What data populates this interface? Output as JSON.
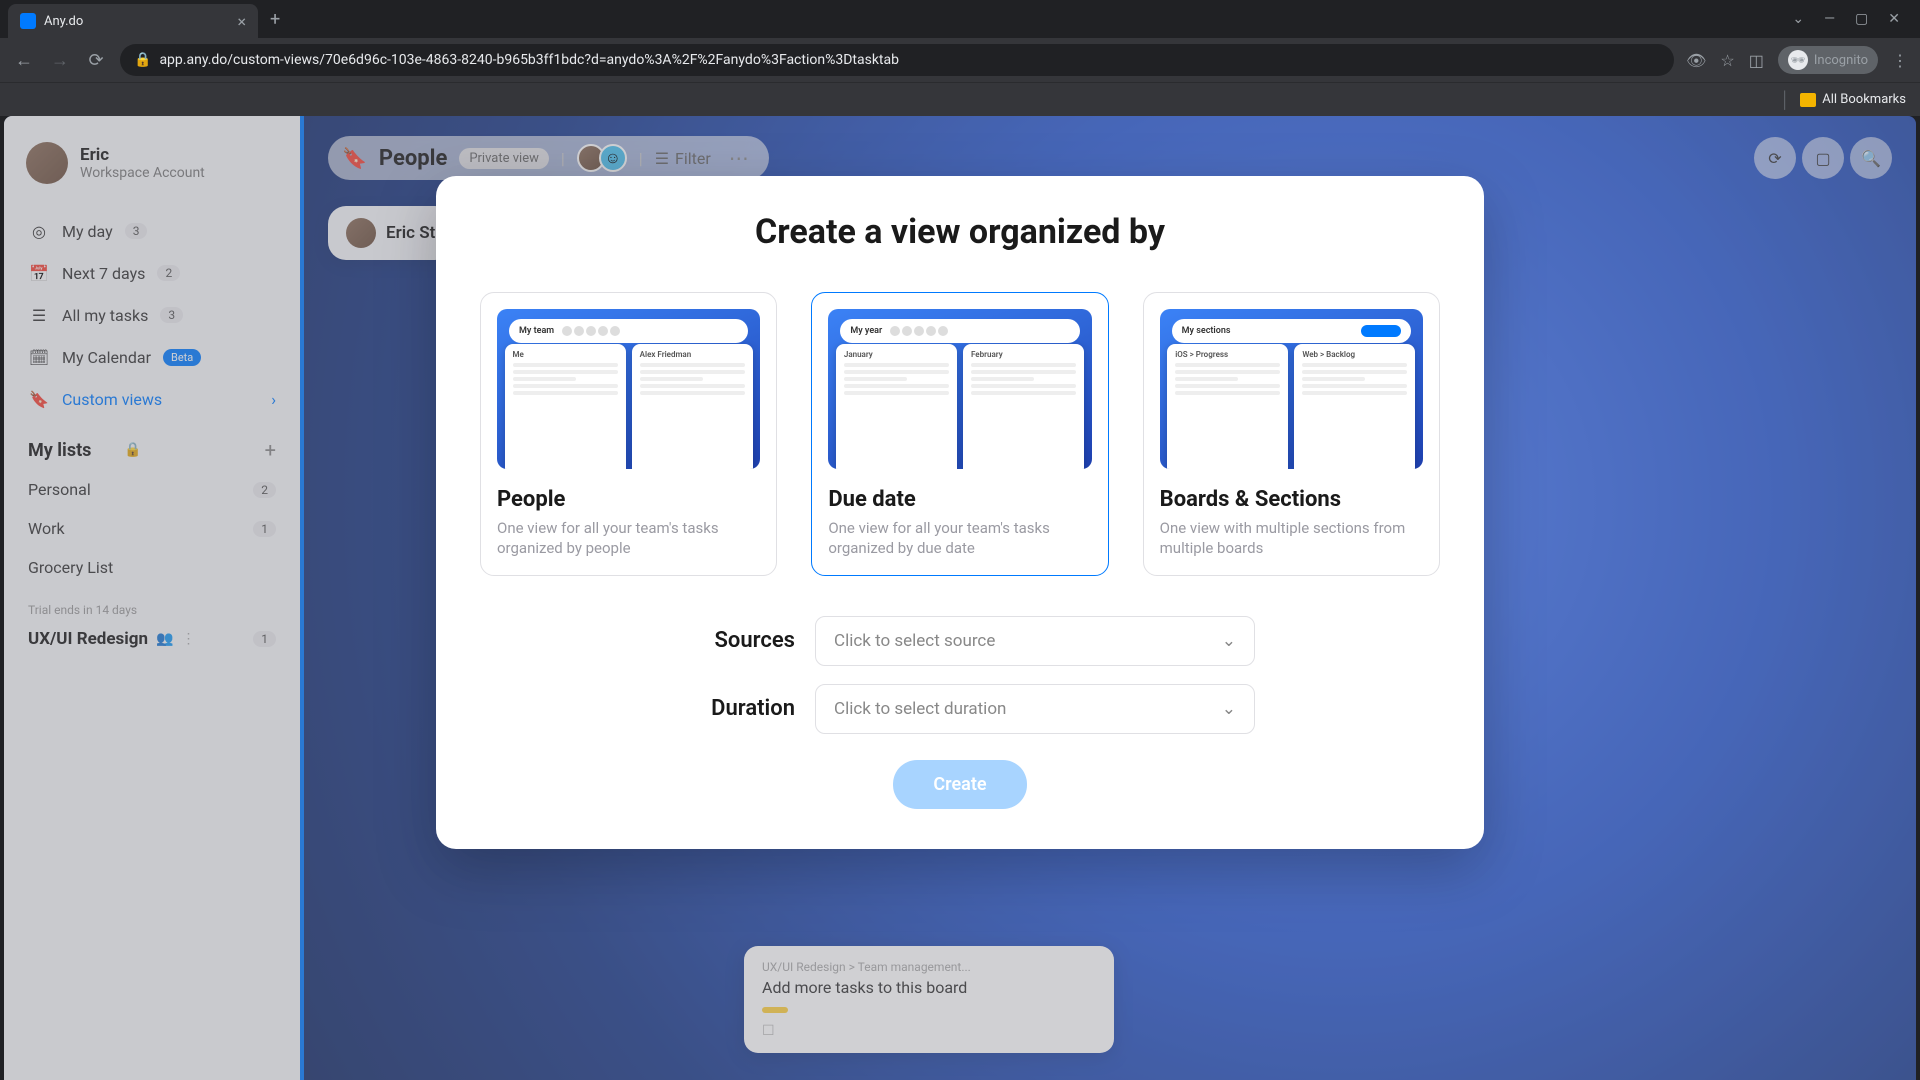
{
  "browser": {
    "tab_title": "Any.do",
    "url": "app.any.do/custom-views/70e6d96c-103e-4863-8240-b965b3ff1bdc?d=anydo%3A%2F%2Fanydo%3Faction%3Dtasktab",
    "incognito_label": "Incognito",
    "bookmarks_label": "All Bookmarks"
  },
  "sidebar": {
    "user": {
      "name": "Eric",
      "subtitle": "Workspace Account"
    },
    "nav": [
      {
        "label": "My day",
        "count": "3"
      },
      {
        "label": "Next 7 days",
        "count": "2"
      },
      {
        "label": "All my tasks",
        "count": "3"
      },
      {
        "label": "My Calendar",
        "badge": "Beta"
      },
      {
        "label": "Custom views"
      }
    ],
    "lists_header": "My lists",
    "lists": [
      {
        "label": "Personal",
        "count": "2"
      },
      {
        "label": "Work",
        "count": "1"
      },
      {
        "label": "Grocery List"
      }
    ],
    "trial_note": "Trial ends in 14 days",
    "project": {
      "title": "UX/UI Redesign",
      "count": "1"
    }
  },
  "header": {
    "view_title": "People",
    "private_badge": "Private view",
    "filter_label": "Filter"
  },
  "background_card": {
    "name": "Eric St"
  },
  "background_task": {
    "breadcrumb": "UX/UI Redesign > Team management...",
    "title": "Add more tasks to this board"
  },
  "modal": {
    "title": "Create a view organized by",
    "options": [
      {
        "title": "People",
        "desc": "One view for all your team's tasks organized by people",
        "preview_header": "My team",
        "col_a": "Me",
        "col_b": "Alex Friedman"
      },
      {
        "title": "Due date",
        "desc": "One view for all your team's tasks organized by due date",
        "preview_header": "My year",
        "col_a": "January",
        "col_b": "February"
      },
      {
        "title": "Boards & Sections",
        "desc": "One view with multiple sections from multiple boards",
        "preview_header": "My sections",
        "col_a": "iOS > Progress",
        "col_b": "Web > Backlog"
      }
    ],
    "sources_label": "Sources",
    "sources_placeholder": "Click to select source",
    "duration_label": "Duration",
    "duration_placeholder": "Click to select duration",
    "create_button": "Create"
  }
}
